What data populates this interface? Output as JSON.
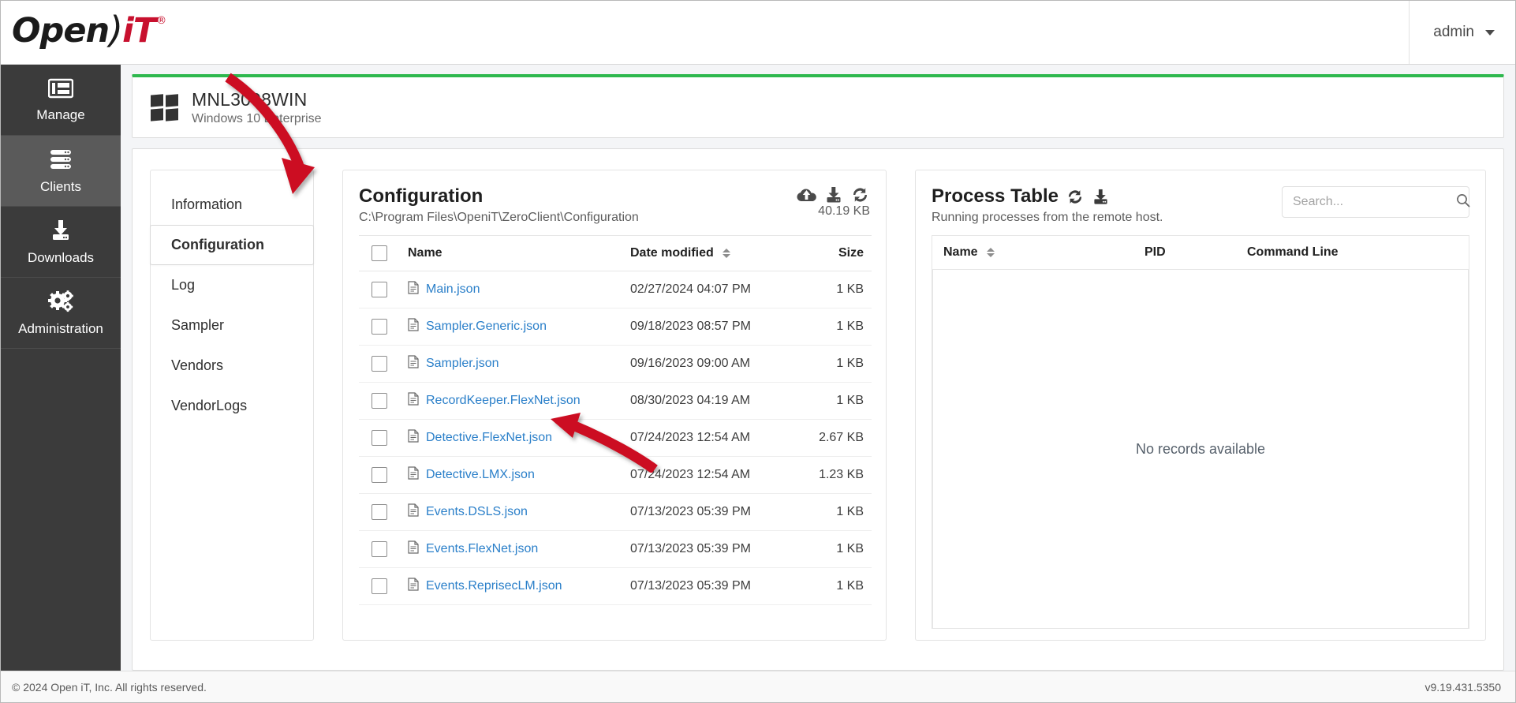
{
  "topbar": {
    "logo_open": "Open",
    "logo_it": "iT",
    "logo_reg": "®",
    "user": "admin",
    "caret_icon": "chevron-down-icon"
  },
  "sidebar": {
    "items": [
      {
        "label": "Manage",
        "icon": "manage-icon",
        "active": false
      },
      {
        "label": "Clients",
        "icon": "server-icon",
        "active": true
      },
      {
        "label": "Downloads",
        "icon": "download-icon",
        "active": false
      },
      {
        "label": "Administration",
        "icon": "gears-icon",
        "active": false
      }
    ]
  },
  "machine": {
    "icon": "windows-icon",
    "name": "MNL3098WIN",
    "os": "Windows 10 Enterprise"
  },
  "tabs": {
    "items": [
      {
        "label": "Information",
        "active": false
      },
      {
        "label": "Configuration",
        "active": true
      },
      {
        "label": "Log",
        "active": false
      },
      {
        "label": "Sampler",
        "active": false
      },
      {
        "label": "Vendors",
        "active": false
      },
      {
        "label": "VendorLogs",
        "active": false
      }
    ]
  },
  "configuration": {
    "title": "Configuration",
    "path": "C:\\Program Files\\OpeniT\\ZeroClient\\Configuration",
    "total_size": "40.19 KB",
    "actions": [
      {
        "name": "cloud-upload-icon",
        "title": "Upload"
      },
      {
        "name": "download-icon",
        "title": "Download"
      },
      {
        "name": "refresh-icon",
        "title": "Refresh"
      }
    ],
    "columns": [
      "",
      "Name",
      "Date modified",
      "Size"
    ],
    "sortable_column": "Date modified",
    "rows": [
      {
        "name": "Main.json",
        "date": "02/27/2024 04:07 PM",
        "size": "1 KB"
      },
      {
        "name": "Sampler.Generic.json",
        "date": "09/18/2023 08:57 PM",
        "size": "1 KB"
      },
      {
        "name": "Sampler.json",
        "date": "09/16/2023 09:00 AM",
        "size": "1 KB"
      },
      {
        "name": "RecordKeeper.FlexNet.json",
        "date": "08/30/2023 04:19 AM",
        "size": "1 KB"
      },
      {
        "name": "Detective.FlexNet.json",
        "date": "07/24/2023 12:54 AM",
        "size": "2.67 KB"
      },
      {
        "name": "Detective.LMX.json",
        "date": "07/24/2023 12:54 AM",
        "size": "1.23 KB"
      },
      {
        "name": "Events.DSLS.json",
        "date": "07/13/2023 05:39 PM",
        "size": "1 KB"
      },
      {
        "name": "Events.FlexNet.json",
        "date": "07/13/2023 05:39 PM",
        "size": "1 KB"
      },
      {
        "name": "Events.ReprisecLM.json",
        "date": "07/13/2023 05:39 PM",
        "size": "1 KB"
      }
    ]
  },
  "process_table": {
    "title": "Process Table",
    "subtitle": "Running processes from the remote host.",
    "actions": [
      {
        "name": "refresh-icon",
        "title": "Refresh"
      },
      {
        "name": "download-icon",
        "title": "Download"
      }
    ],
    "search_placeholder": "Search...",
    "search_value": "",
    "search_icon": "search-icon",
    "columns": [
      "Name",
      "PID",
      "Command Line"
    ],
    "sortable_column": "Name",
    "empty_message": "No records available",
    "rows": []
  },
  "footer": {
    "copyright": "© 2024 Open iT, Inc. All rights reserved.",
    "version": "v9.19.431.5350"
  },
  "colors": {
    "accent_green": "#2eb84e",
    "link_blue": "#2a7fc9",
    "brand_red": "#c8102e",
    "sidebar_bg": "#3b3b3b",
    "annotation_red": "#cc1122"
  }
}
